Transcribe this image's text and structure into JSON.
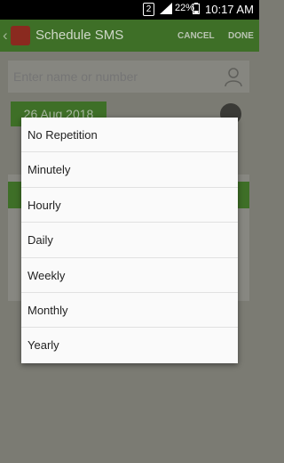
{
  "status_bar": {
    "sim": "2",
    "battery_percent": "22%",
    "time": "10:17 AM"
  },
  "app_bar": {
    "title": "Schedule SMS",
    "cancel_label": "CANCEL",
    "done_label": "DONE"
  },
  "form": {
    "contact_placeholder": "Enter name or number",
    "date": "26 Aug 2018"
  },
  "repeat_dialog": {
    "options": [
      "No Repetition",
      "Minutely",
      "Hourly",
      "Daily",
      "Weekly",
      "Monthly",
      "Yearly"
    ]
  },
  "colors": {
    "accent": "#4caf50",
    "statusbar": "#000000"
  }
}
